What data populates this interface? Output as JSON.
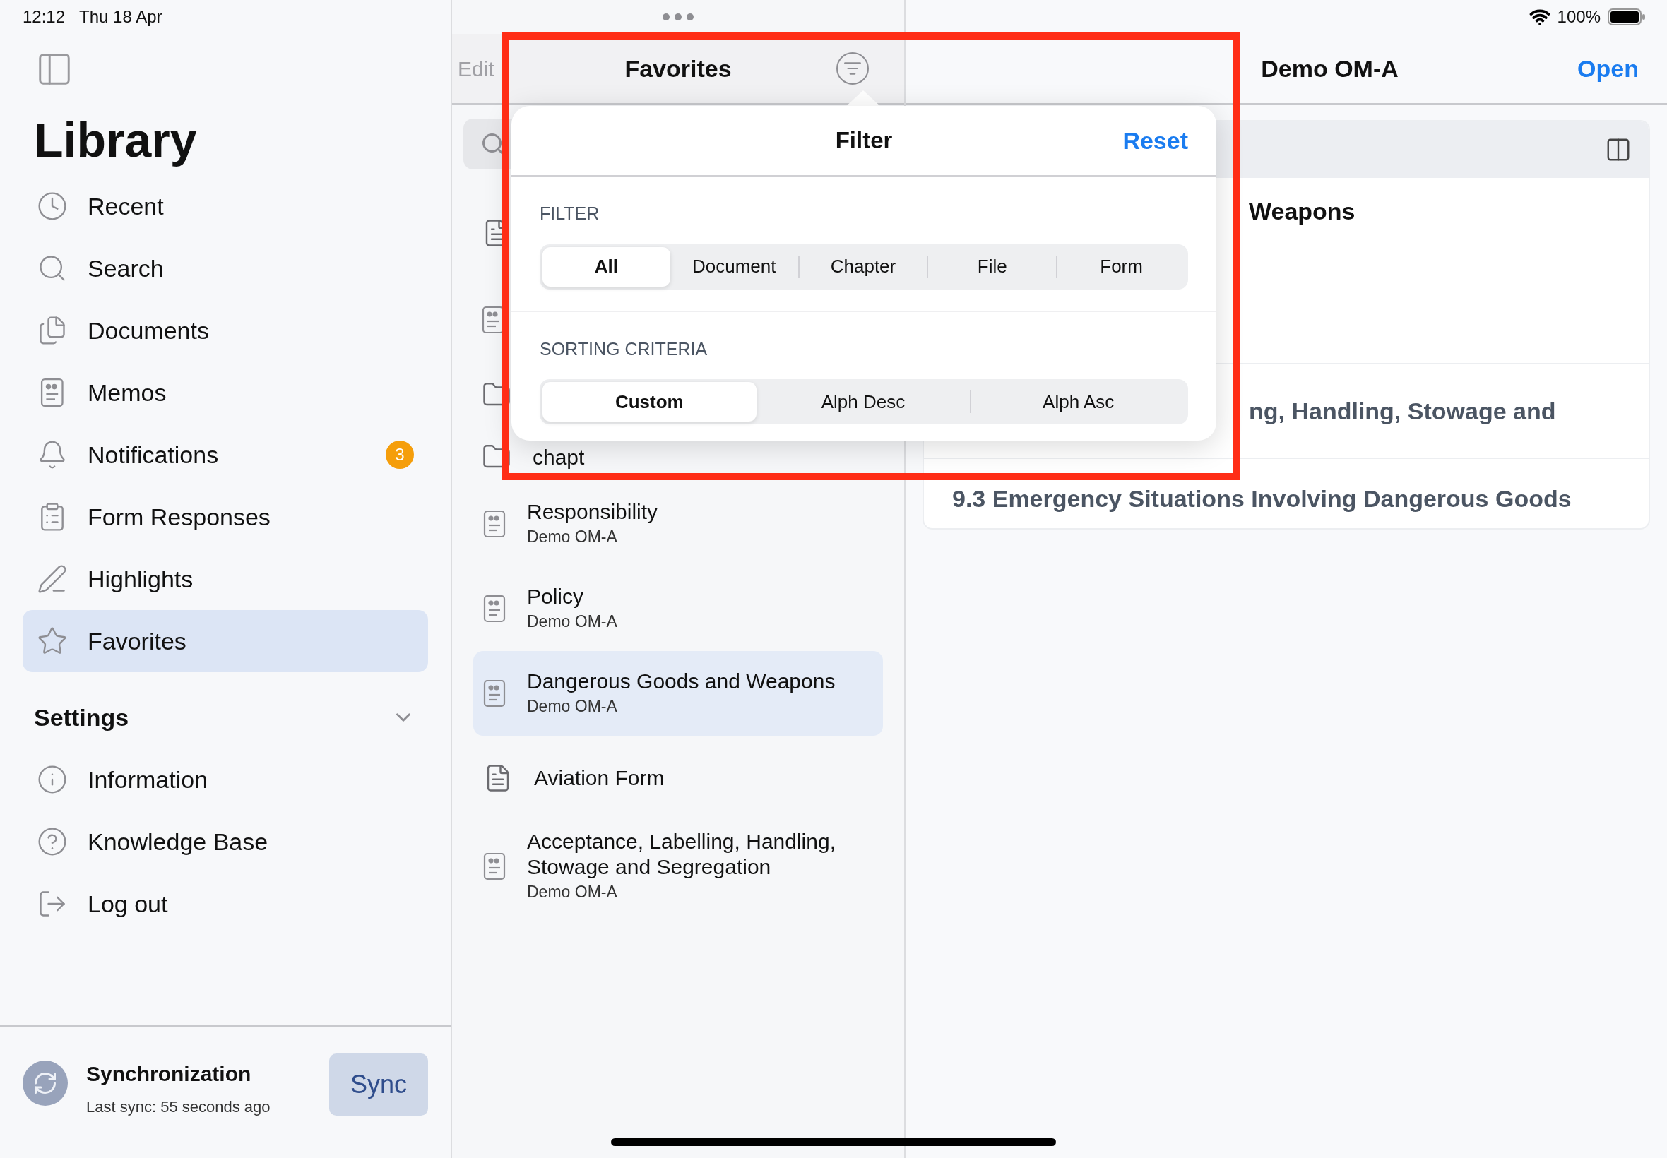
{
  "status_bar": {
    "time": "12:12",
    "date": "Thu 18 Apr",
    "battery": "100%"
  },
  "sidebar": {
    "title": "Library",
    "items": [
      {
        "kind": "recent",
        "label": "Recent",
        "selected": false
      },
      {
        "kind": "search",
        "label": "Search",
        "selected": false
      },
      {
        "kind": "documents",
        "label": "Documents",
        "selected": false
      },
      {
        "kind": "memos",
        "label": "Memos",
        "selected": false
      },
      {
        "kind": "notifications",
        "label": "Notifications",
        "selected": false,
        "badge": "3"
      },
      {
        "kind": "forms",
        "label": "Form Responses",
        "selected": false
      },
      {
        "kind": "highlights",
        "label": "Highlights",
        "selected": false
      },
      {
        "kind": "favorites",
        "label": "Favorites",
        "selected": true
      }
    ],
    "settings": {
      "title": "Settings",
      "expanded": true,
      "items": [
        {
          "kind": "information",
          "label": "Information"
        },
        {
          "kind": "help",
          "label": "Knowledge Base"
        },
        {
          "kind": "logout",
          "label": "Log out"
        }
      ]
    },
    "sync": {
      "title": "Synchronization",
      "subtitle": "Last sync: 55 seconds ago",
      "button": "Sync"
    }
  },
  "list": {
    "edit": "Edit",
    "title": "Favorites",
    "hidden_rows": [
      {
        "kind": "document"
      },
      {
        "kind": "memo"
      },
      {
        "kind": "folder"
      },
      {
        "kind": "folder",
        "title": "chapt"
      }
    ],
    "rows": [
      {
        "kind": "memo",
        "title": "Responsibility",
        "subtitle": "Demo OM-A",
        "selected": false
      },
      {
        "kind": "memo",
        "title": "Policy",
        "subtitle": "Demo OM-A",
        "selected": false
      },
      {
        "kind": "memo",
        "title": "Dangerous Goods and Weapons",
        "subtitle": "Demo OM-A",
        "selected": true
      },
      {
        "kind": "document",
        "title": "Aviation Form",
        "selected": false
      },
      {
        "kind": "memo",
        "title": "Acceptance, Labelling, Handling, Stowage and Segregation",
        "subtitle": "Demo OM-A",
        "selected": false
      }
    ]
  },
  "filter_popover": {
    "title": "Filter",
    "reset": "Reset",
    "filter_label": "FILTER",
    "filter_options": [
      {
        "label": "All",
        "selected": true
      },
      {
        "label": "Document",
        "selected": false
      },
      {
        "label": "Chapter",
        "selected": false
      },
      {
        "label": "File",
        "selected": false
      },
      {
        "label": "Form",
        "selected": false
      }
    ],
    "sorting_label": "SORTING CRITERIA",
    "sorting_options": [
      {
        "label": "Custom",
        "selected": true
      },
      {
        "label": "Alph Desc",
        "selected": false
      },
      {
        "label": "Alph Asc",
        "selected": false
      }
    ]
  },
  "detail": {
    "title": "Demo OM-A",
    "open": "Open",
    "rows": [
      {
        "kind": "heading",
        "text": "Weapons"
      },
      {
        "kind": "entry",
        "text": "ng, Handling, Stowage and"
      },
      {
        "kind": "entry",
        "text": "9.3 Emergency Situations Involving Dangerous Goods"
      }
    ]
  }
}
